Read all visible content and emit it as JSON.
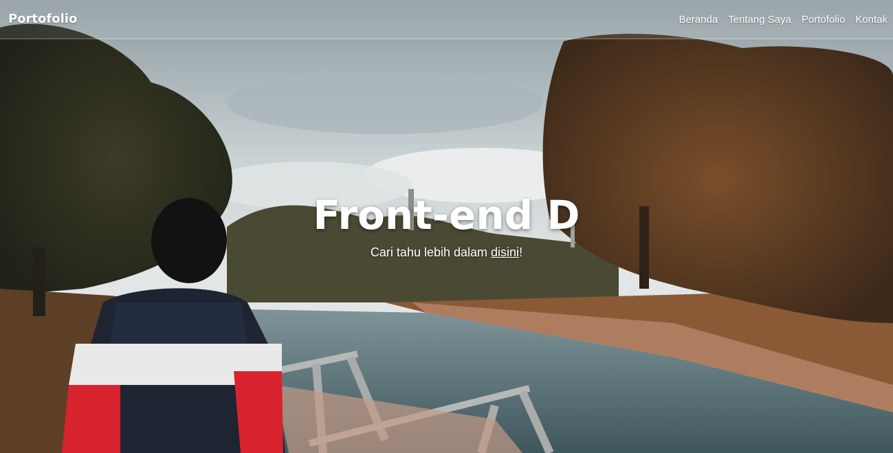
{
  "navbar": {
    "brand": "Portofolio",
    "links": [
      "Beranda",
      "Tentang Saya",
      "Portofolio",
      "Kontak"
    ]
  },
  "hero": {
    "title": "Front-end D",
    "subtitle_prefix": "Cari tahu lebih dalam ",
    "subtitle_link": "disini",
    "subtitle_suffix": "!"
  },
  "colors": {
    "text": "#ffffff",
    "sky": "#b8c3c7",
    "foliage": "#6a4a2e",
    "water": "#4f6b72"
  }
}
